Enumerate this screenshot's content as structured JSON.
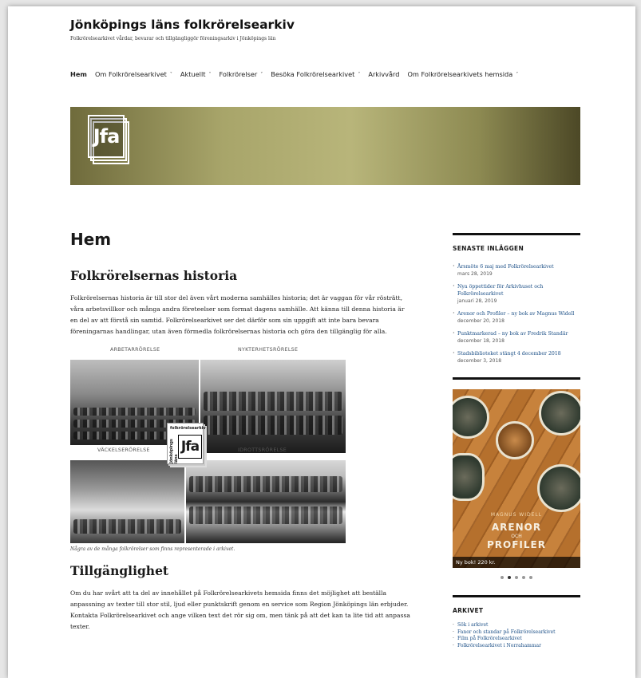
{
  "site": {
    "title": "Jönköpings läns folkrörelsearkiv",
    "description": "Folkrörelsearkivet vårdar, bevarar och tillgängliggör föreningsarkiv i Jönköpings län"
  },
  "nav": {
    "items": [
      {
        "label": "Hem",
        "caret": false,
        "active": true
      },
      {
        "label": "Om Folkrörelsearkivet",
        "caret": true
      },
      {
        "label": "Aktuellt",
        "caret": true
      },
      {
        "label": "Folkrörelser",
        "caret": true
      },
      {
        "label": "Besöka Folkrörelsearkivet",
        "caret": true
      },
      {
        "label": "Arkivvård",
        "caret": false
      },
      {
        "label": "Om Folkrörelsearkivets hemsida",
        "caret": true
      }
    ],
    "caret_glyph": "˅"
  },
  "header": {
    "logo_text": "Jfa"
  },
  "main": {
    "page_title": "Hem",
    "section1_heading": "Folkrörelsernas historia",
    "section1_text": "Folkrörelsernas historia är till stor del även vårt moderna samhälles historia; det är vaggan för vår rösträtt, våra arbetsvillkor och många andra företeelser som format dagens samhälle. Att känna till denna historia är en del av att förstå sin samtid. Folkrörelsearkivet ser det därför som sin uppgift att inte bara bevara föreningarnas handlingar, utan även förmedla folkrörelsernas historia och göra den tillgänglig för alla.",
    "collage": {
      "captions": [
        "ARBETARRÖRELSE",
        "NYKTERHETSRÖRELSE",
        "VÄCKELSERÖRELSE",
        "IDROTTSRÖRELSE"
      ],
      "logo_top": "folkrörelsearkiv",
      "logo_side": "Jönköpings läns",
      "logo_mark": "Jfa"
    },
    "figure_caption": "Några av de många folkrörelser som finns representerade i arkivet.",
    "section2_heading": "Tillgänglighet",
    "section2_text": "Om du har svårt att ta del av innehållet på Folkrörelsearkivets hemsida finns det möjlighet att beställa anpassning av texter till stor stil, ljud eller punktskrift genom en service som Region Jönköpings län erbjuder. Kontakta Folkrörelsearkivet och ange vilken text det rör sig om, men tänk på att det kan ta lite tid att anpassa texter."
  },
  "sidebar": {
    "recent_title": "SENASTE INLÄGGEN",
    "posts": [
      {
        "title": "Årsmöte 6 maj med Folkrörelsearkivet",
        "date": "mars 28, 2019"
      },
      {
        "title": "Nya öppettider för Arkivhuset och Folkrörelsearkivet",
        "date": "januari 28, 2019"
      },
      {
        "title": "Arenor och Profiler – ny bok av Magnus Widell",
        "date": "december 20, 2018"
      },
      {
        "title": "Punktmarkerad – ny bok av Fredrik Standär",
        "date": "december 18, 2018"
      },
      {
        "title": "Stadsbiblioteket stängt 4 december 2018",
        "date": "december 3, 2018"
      }
    ],
    "ad": {
      "author": "MAGNUS WIDELL",
      "title1": "ARENOR",
      "title_and": "OCH",
      "title2": "PROFILER",
      "banner": "Ny bok! 220 kr."
    },
    "slider_dots": 5,
    "slider_active": 1,
    "archive_title": "ARKIVET",
    "archive_links": [
      "Sök i arkivet",
      "Fanor och standar på Folkrörelsearkivet",
      "Film på Folkrörelsearkivet",
      "Folkrörelsearkivet i Norrahammar"
    ]
  }
}
